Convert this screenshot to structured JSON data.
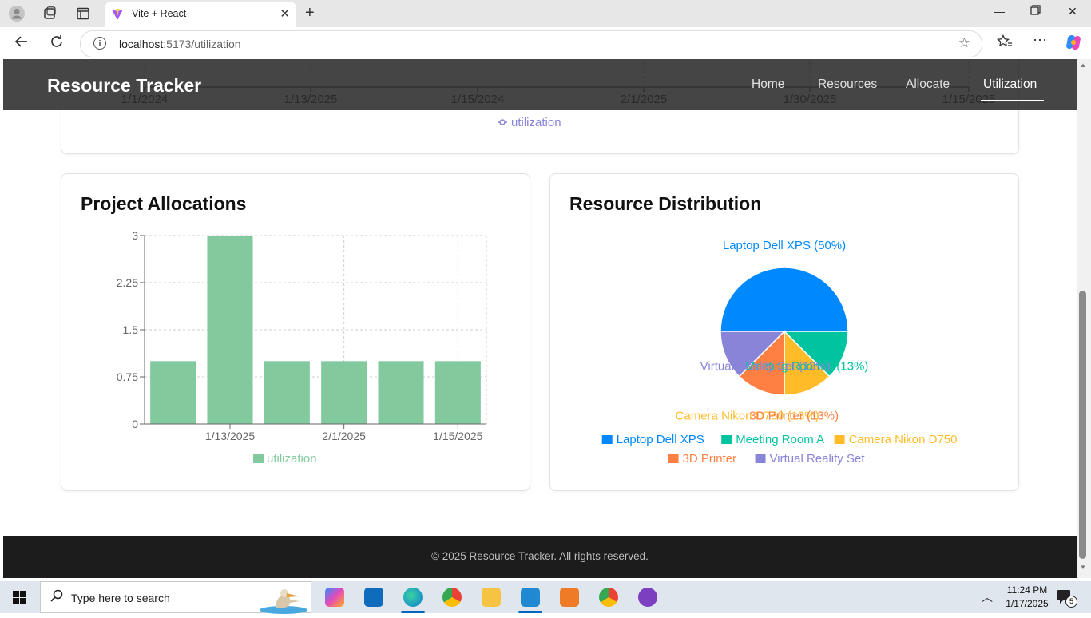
{
  "browser": {
    "tab_title": "Vite + React",
    "url_host": "localhost",
    "url_path": ":5173/utilization"
  },
  "nav": {
    "brand": "Resource Tracker",
    "links": [
      "Home",
      "Resources",
      "Allocate",
      "Utilization"
    ],
    "active": "Utilization"
  },
  "line_chart": {
    "x_tick_labels": [
      "1/1/2024",
      "1/13/2025",
      "1/15/2024",
      "2/1/2025",
      "1/30/2025",
      "1/15/2025"
    ],
    "legend": "utilization",
    "color": "#8884d8"
  },
  "project_allocations": {
    "title": "Project Allocations",
    "legend": "utilization",
    "color": "#82ca9d"
  },
  "resource_distribution": {
    "title": "Resource Distribution",
    "legend": [
      "Laptop Dell XPS",
      "Meeting Room A",
      "Camera Nikon D750",
      "3D Printer",
      "Virtual Reality Set"
    ]
  },
  "footer": {
    "text": "© 2025 Resource Tracker. All rights reserved."
  },
  "taskbar": {
    "search_placeholder": "Type here to search",
    "time": "11:24 PM",
    "date": "1/17/2025",
    "notification_count": "5"
  },
  "chart_data": [
    {
      "type": "bar",
      "title": "Project Allocations",
      "categories": [
        "",
        "1/13/2025",
        "",
        "2/1/2025",
        "",
        "1/15/2025"
      ],
      "series": [
        {
          "name": "utilization",
          "values": [
            1,
            3,
            1,
            1,
            1,
            1
          ]
        }
      ],
      "ylim": [
        0,
        3
      ],
      "yticks": [
        "0",
        "0.75",
        "1.5",
        "2.25",
        "3"
      ],
      "grid": true,
      "legend_position": "bottom"
    },
    {
      "type": "pie",
      "title": "Resource Distribution",
      "slices": [
        {
          "label": "Laptop Dell XPS",
          "percent_label": "Laptop Dell XPS (50%)",
          "value": 50,
          "color": "#0088FE"
        },
        {
          "label": "Meeting Room A",
          "percent_label": "Meeting Room A (13%)",
          "value": 12.5,
          "color": "#00C49F"
        },
        {
          "label": "Camera Nikon D750",
          "percent_label": "Camera Nikon D750 (13%)",
          "value": 12.5,
          "color": "#FFBB28"
        },
        {
          "label": "3D Printer",
          "percent_label": "3D Printer (13%)",
          "value": 12.5,
          "color": "#FF8042"
        },
        {
          "label": "Virtual Reality Set",
          "percent_label": "Virtual Reality Set (13%)",
          "value": 12.5,
          "color": "#8884D8"
        }
      ],
      "legend_position": "bottom"
    }
  ]
}
